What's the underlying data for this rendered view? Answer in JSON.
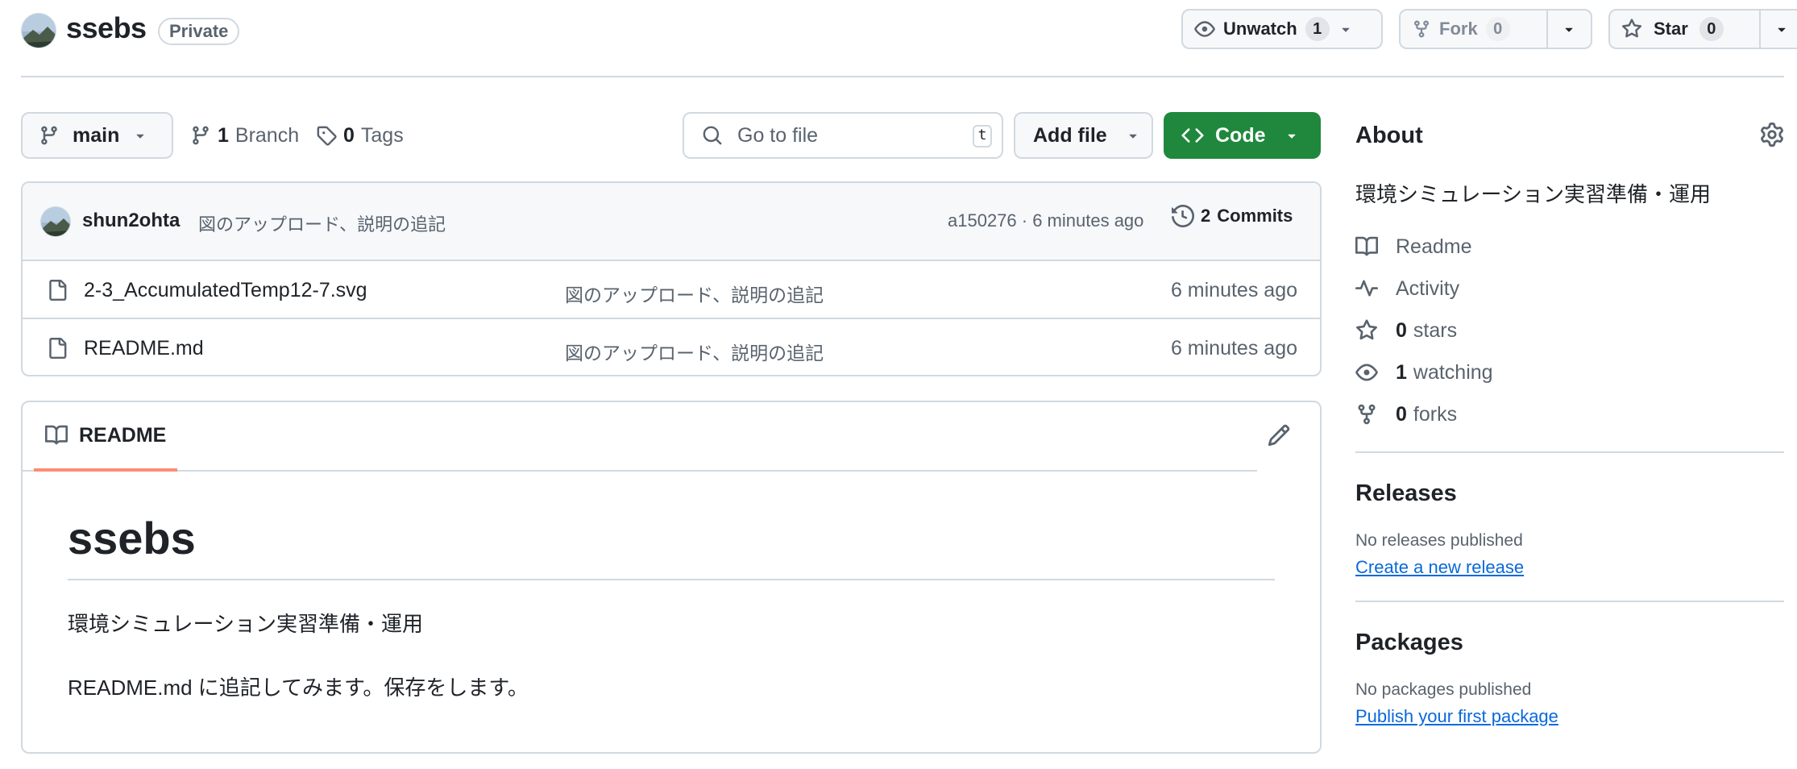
{
  "repo": {
    "name": "ssebs",
    "visibility": "Private"
  },
  "actions": {
    "watch_label": "Unwatch",
    "watch_count": "1",
    "fork_label": "Fork",
    "fork_count": "0",
    "star_label": "Star",
    "star_count": "0"
  },
  "toolbar": {
    "branch": "main",
    "branches_count": "1",
    "branches_label": "Branch",
    "tags_count": "0",
    "tags_label": "Tags",
    "search_placeholder": "Go to file",
    "search_shortcut": "t",
    "add_file_label": "Add file",
    "code_label": "Code"
  },
  "latest_commit": {
    "author": "shun2ohta",
    "message": "図のアップロード、説明の追記",
    "hash_time": "a150276 · 6 minutes ago",
    "commits_count": "2",
    "commits_label": "Commits"
  },
  "files": [
    {
      "name": "2-3_AccumulatedTemp12-7.svg",
      "message": "図のアップロード、説明の追記",
      "time": "6 minutes ago"
    },
    {
      "name": "README.md",
      "message": "図のアップロード、説明の追記",
      "time": "6 minutes ago"
    }
  ],
  "readme": {
    "tab_label": "README",
    "heading": "ssebs",
    "paragraph1": "環境シミュレーション実習準備・運用",
    "paragraph2": "README.md に追記してみます。保存をします。"
  },
  "sidebar": {
    "about_title": "About",
    "description": "環境シミュレーション実習準備・運用",
    "readme_label": "Readme",
    "activity_label": "Activity",
    "stars_count": "0",
    "stars_label": "stars",
    "watching_count": "1",
    "watching_label": "watching",
    "forks_count": "0",
    "forks_label": "forks",
    "releases_title": "Releases",
    "releases_note": "No releases published",
    "releases_link": "Create a new release",
    "packages_title": "Packages",
    "packages_note": "No packages published",
    "packages_link": "Publish your first package"
  },
  "colors": {
    "accent_green": "#1f883d",
    "link_blue": "#0969da",
    "tab_underline": "#fd8c73",
    "border": "#d1d9e0",
    "muted_text": "#59636e"
  }
}
